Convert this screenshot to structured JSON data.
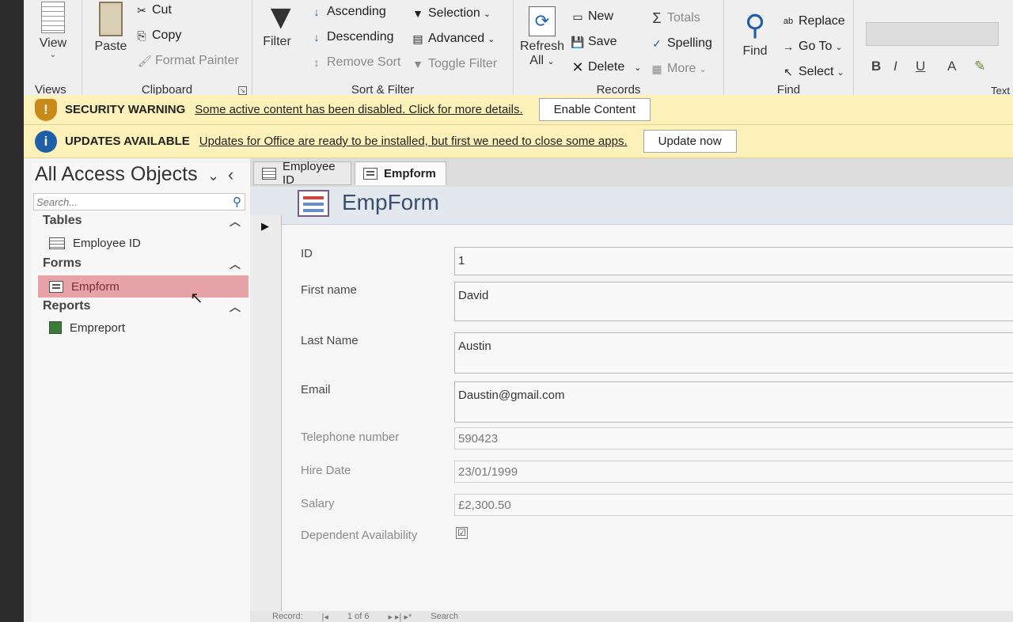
{
  "ribbon": {
    "views": {
      "view_label": "View",
      "group_label": "Views"
    },
    "clipboard": {
      "paste_label": "Paste",
      "cut_label": "Cut",
      "copy_label": "Copy",
      "format_painter_label": "Format Painter",
      "group_label": "Clipboard"
    },
    "sort_filter": {
      "filter_label": "Filter",
      "ascending_label": "Ascending",
      "descending_label": "Descending",
      "remove_sort_label": "Remove Sort",
      "selection_label": "Selection",
      "advanced_label": "Advanced",
      "toggle_filter_label": "Toggle Filter",
      "group_label": "Sort & Filter"
    },
    "records": {
      "refresh_label": "Refresh",
      "refresh_all_label": "All",
      "new_label": "New",
      "save_label": "Save",
      "delete_label": "Delete",
      "totals_label": "Totals",
      "spelling_label": "Spelling",
      "more_label": "More",
      "group_label": "Records"
    },
    "find": {
      "find_label": "Find",
      "replace_label": "Replace",
      "goto_label": "Go To",
      "select_label": "Select",
      "group_label": "Find"
    },
    "text_formatting": {
      "bold_label": "B",
      "italic_label": "I",
      "underline_label": "U",
      "font_color_label": "A",
      "group_label": "Text"
    }
  },
  "security_bar": {
    "title": "SECURITY WARNING",
    "message": "Some active content has been disabled. Click for more details.",
    "button_label": "Enable Content",
    "icon": "!"
  },
  "updates_bar": {
    "title": "UPDATES AVAILABLE",
    "message": "Updates for Office are ready to be installed, but first we need to close some apps.",
    "button_label": "Update now",
    "icon": "i"
  },
  "nav_pane": {
    "title": "All Access Objects",
    "search_placeholder": "Search...",
    "sections": [
      {
        "label": "Tables",
        "items": [
          "Employee ID"
        ]
      },
      {
        "label": "Forms",
        "items": [
          "Empform"
        ]
      },
      {
        "label": "Reports",
        "items": [
          "Empreport"
        ]
      }
    ]
  },
  "tabs": [
    {
      "label": "Employee ID"
    },
    {
      "label": "Empform"
    }
  ],
  "form": {
    "title": "EmpForm",
    "fields": [
      {
        "label": "ID",
        "value": "1"
      },
      {
        "label": "First name",
        "value": "David"
      },
      {
        "label": "Last Name",
        "value": "Austin"
      },
      {
        "label": "Email",
        "value": "Daustin@gmail.com"
      },
      {
        "label": "Telephone number",
        "value": "590423"
      },
      {
        "label": "Hire Date",
        "value": "23/01/1999"
      },
      {
        "label": "Salary",
        "value": "£2,300.50"
      },
      {
        "label": "Dependent Availability",
        "value": "☑"
      }
    ]
  },
  "status_bar": {
    "record_label": "Record:",
    "record_position": "1 of 6",
    "search_label": "Search"
  },
  "colors": {
    "security_bar_bg": "#fdf1ba",
    "security_icon": "#c98a1a",
    "updates_icon": "#1f5fa8",
    "nav_selected_bg": "#e8a3a8",
    "form_header_bg": "#e3e8ef"
  }
}
